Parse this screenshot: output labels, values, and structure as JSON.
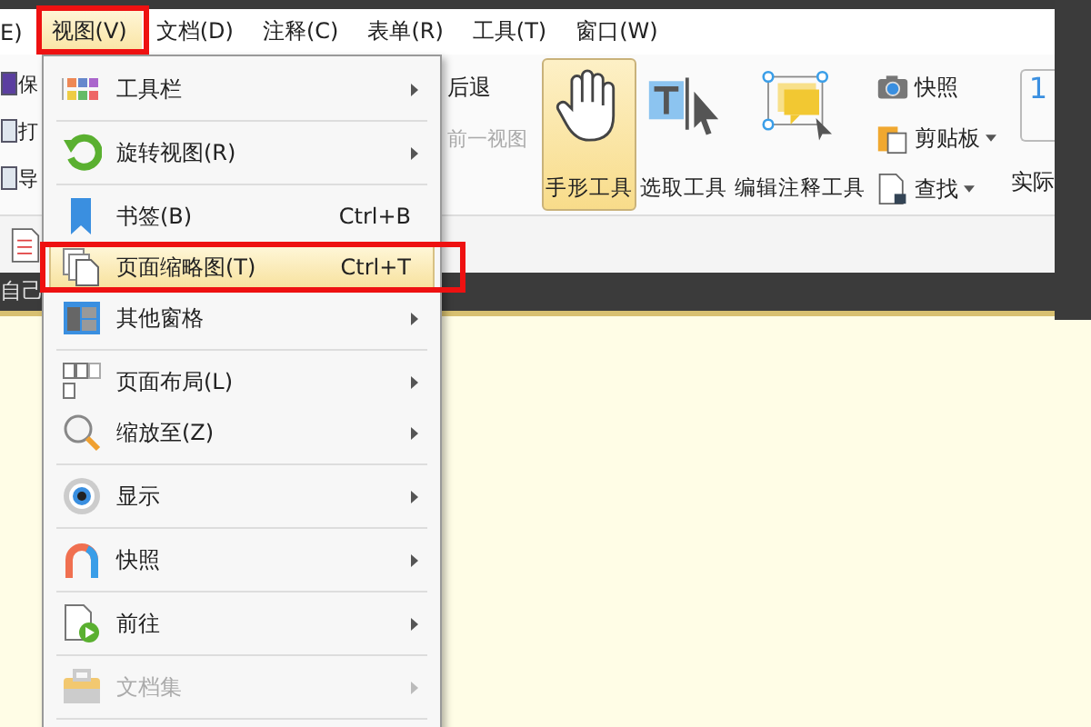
{
  "menubar": [
    {
      "label": "E)",
      "selected": false
    },
    {
      "label": "视图(V)",
      "selected": true
    },
    {
      "label": "文档(D)",
      "selected": false
    },
    {
      "label": "注释(C)",
      "selected": false
    },
    {
      "label": "表单(R)",
      "selected": false
    },
    {
      "label": "工具(T)",
      "selected": false
    },
    {
      "label": "窗口(W)",
      "selected": false
    }
  ],
  "toolbar_left": [
    "保",
    "打",
    "导"
  ],
  "toolbar": {
    "back": "后退",
    "previous_view": {
      "label": "前一视图",
      "disabled": true
    },
    "tools": [
      {
        "label": "手形工具",
        "selected": true
      },
      {
        "label": "选取工具",
        "selected": false
      },
      {
        "label": "编辑注释工具",
        "selected": false
      }
    ],
    "small_tools": [
      {
        "label": "快照",
        "dropdown": false
      },
      {
        "label": "剪贴板",
        "dropdown": true
      },
      {
        "label": "查找",
        "dropdown": true
      }
    ],
    "actual_size": {
      "label": "实际",
      "preview": "1"
    }
  },
  "panel_tab": "自己",
  "view_menu": [
    {
      "label": "工具栏",
      "submenu": true,
      "divider": true,
      "selected": false,
      "disabled": false
    },
    {
      "label": "旋转视图(R)",
      "submenu": true,
      "divider": true,
      "selected": false,
      "disabled": false
    },
    {
      "label": "书签(B)",
      "shortcut": "Ctrl+B",
      "submenu": false,
      "divider": false,
      "selected": false,
      "disabled": false
    },
    {
      "label": "页面缩略图(T)",
      "shortcut": "Ctrl+T",
      "submenu": false,
      "divider": false,
      "selected": true,
      "disabled": false
    },
    {
      "label": "其他窗格",
      "submenu": true,
      "divider": true,
      "selected": false,
      "disabled": false
    },
    {
      "label": "页面布局(L)",
      "submenu": true,
      "divider": false,
      "selected": false,
      "disabled": false
    },
    {
      "label": "缩放至(Z)",
      "submenu": true,
      "divider": true,
      "selected": false,
      "disabled": false
    },
    {
      "label": "显示",
      "submenu": true,
      "divider": true,
      "selected": false,
      "disabled": false
    },
    {
      "label": "快照",
      "submenu": true,
      "divider": true,
      "selected": false,
      "disabled": false
    },
    {
      "label": "前往",
      "submenu": true,
      "divider": true,
      "selected": false,
      "disabled": false
    },
    {
      "label": "文档集",
      "submenu": true,
      "divider": true,
      "selected": false,
      "disabled": true
    }
  ]
}
